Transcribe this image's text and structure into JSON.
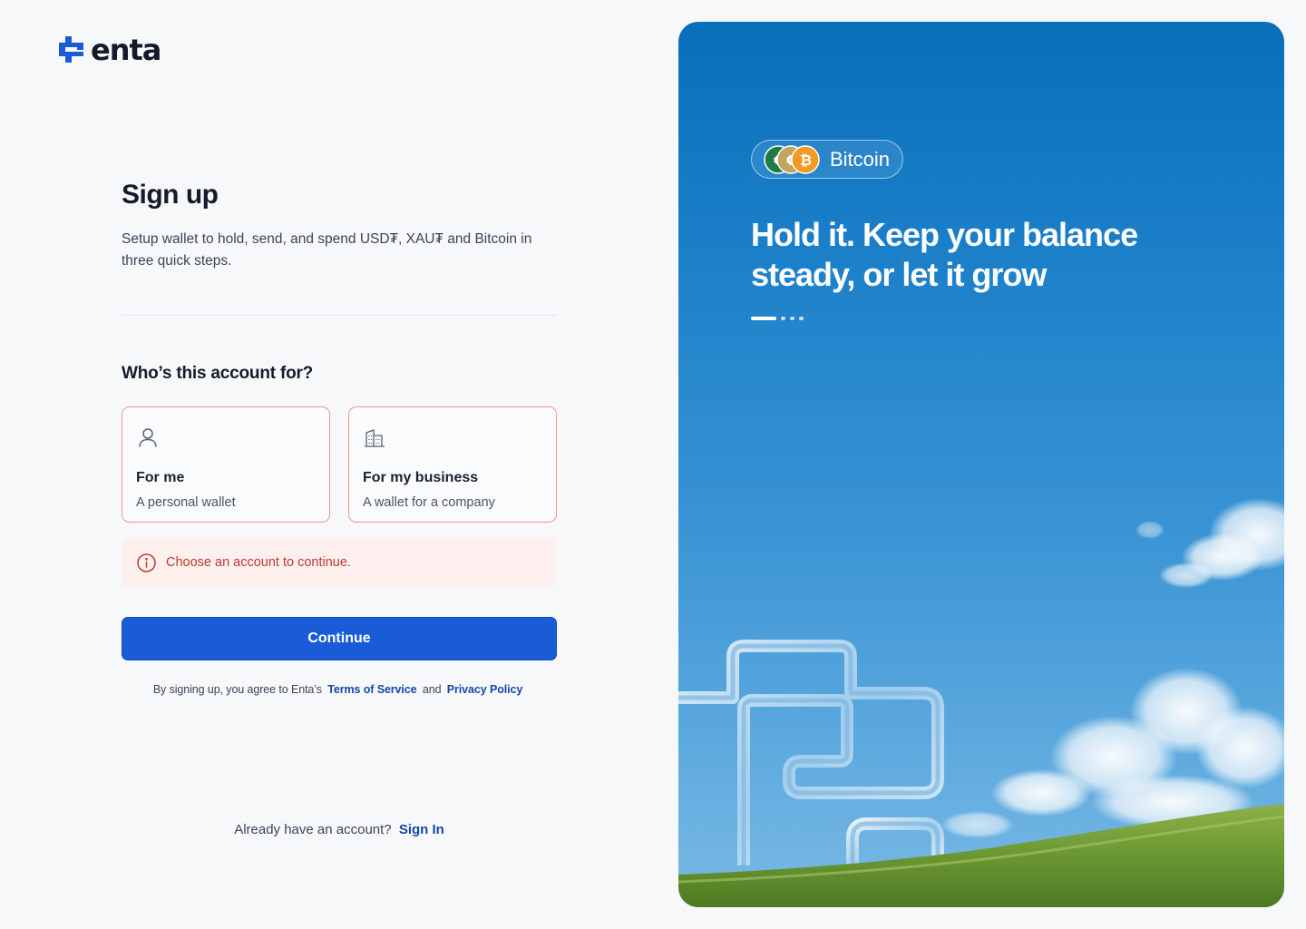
{
  "brand": {
    "name": "enta",
    "logo_icon": "enta-logo-icon",
    "accent_color": "#1a5cd8"
  },
  "signup": {
    "title": "Sign up",
    "subtitle": "Setup wallet to hold, send, and spend USD₮, XAU₮ and Bitcoin in three quick steps.",
    "question": "Who’s this account for?",
    "options": [
      {
        "icon": "user-icon",
        "title": "For me",
        "description": "A personal wallet"
      },
      {
        "icon": "building-icon",
        "title": "For my business",
        "description": "A wallet for a company"
      }
    ],
    "error": {
      "icon": "info-circle-icon",
      "message": "Choose an account to continue.",
      "color": "#c0392b"
    },
    "continue_label": "Continue",
    "legal": {
      "prefix": "By signing up, you agree to Enta’s",
      "terms": "Terms of Service",
      "and": "and",
      "privacy": "Privacy Policy"
    },
    "signin": {
      "prompt": "Already have an account?",
      "link": "Sign In"
    }
  },
  "hero": {
    "pill_label": "Bitcoin",
    "coin_icons": [
      "euro-coin-icon",
      "gold-coin-icon",
      "bitcoin-coin-icon"
    ],
    "headline": "Hold it. Keep your balance steady, or let it grow",
    "carousel": {
      "slides": 4,
      "active": 1
    }
  }
}
